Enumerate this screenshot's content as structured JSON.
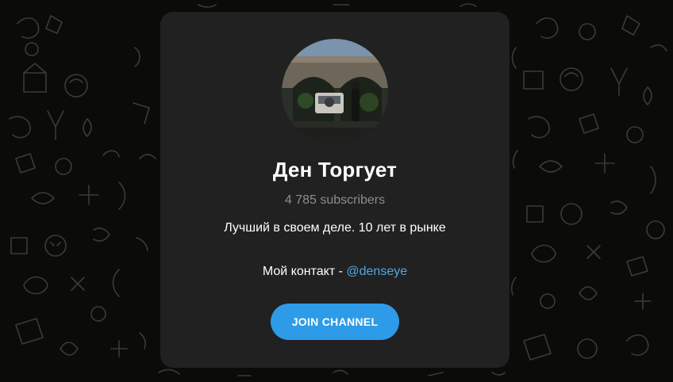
{
  "channel": {
    "title": "Ден Торгует",
    "subscribers": "4 785 subscribers",
    "description": "Лучший в своем деле. 10 лет в рынке",
    "contact_prefix": "Мой контакт - ",
    "contact_handle": "@denseye",
    "join_label": "JOIN CHANNEL"
  },
  "colors": {
    "background": "#0b0b0a",
    "doodle": "#3a3d33",
    "card": "#212121",
    "accent": "#2d9be8",
    "link": "#4fa8e6",
    "muted_text": "#8d8d8d"
  },
  "icons": {
    "background_pattern": "doodle-pattern",
    "avatar": "channel-avatar-photo"
  }
}
